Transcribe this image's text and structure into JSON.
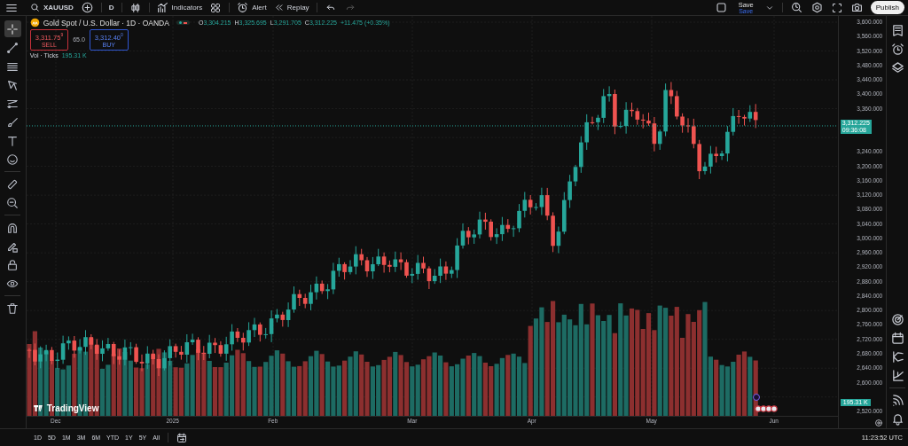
{
  "top_toolbar": {
    "symbol": "XAUUSD",
    "interval": "D",
    "indicators": "Indicators",
    "alert": "Alert",
    "replay": "Replay",
    "save": "Save",
    "save_note": "Save",
    "publish": "Publish"
  },
  "left_toolbar": [
    {
      "kind": "crosshair",
      "selected": true
    },
    {
      "kind": "line",
      "selected": false
    },
    {
      "kind": "fib",
      "selected": false
    },
    {
      "kind": "pattern",
      "selected": false
    },
    {
      "kind": "projection",
      "selected": false
    },
    {
      "kind": "brush",
      "selected": false
    },
    {
      "kind": "text",
      "selected": false
    },
    {
      "kind": "smiley",
      "selected": false
    },
    {
      "kind": "divider"
    },
    {
      "kind": "ruler",
      "selected": false
    },
    {
      "kind": "zoom",
      "selected": false
    },
    {
      "kind": "divider"
    },
    {
      "kind": "magnet",
      "selected": false
    },
    {
      "kind": "pencil-lock",
      "selected": false
    },
    {
      "kind": "lock",
      "selected": false
    },
    {
      "kind": "eye",
      "selected": false
    },
    {
      "kind": "divider"
    },
    {
      "kind": "trash",
      "selected": false
    }
  ],
  "legend": {
    "title": "Gold Spot / U.S. Dollar · 1D · OANDA",
    "ohlc": [
      {
        "key": "O",
        "value": "3,304.215"
      },
      {
        "key": "H",
        "value": "3,325.695"
      },
      {
        "key": "L",
        "value": "3,291.705"
      },
      {
        "key": "C",
        "value": "3,312.225"
      }
    ],
    "change": "+11.475 (+0.35%)"
  },
  "trade": {
    "sell_price": "3,311.75$^{9}$",
    "sell_label": "SELL",
    "spread": "65.0",
    "buy_price": "3,312.40$^{0}$",
    "buy_label": "BUY"
  },
  "volume_legend": {
    "label": "Vol · Ticks",
    "value": "195.31 K"
  },
  "price_axis": {
    "ticks": [
      "3,600.000",
      "3,560.000",
      "3,520.000",
      "3,480.000",
      "3,440.000",
      "3,400.000",
      "3,360.000",
      "3,240.000",
      "3,200.000",
      "3,160.000",
      "3,120.000",
      "3,080.000",
      "3,040.000",
      "3,000.000",
      "2,960.000",
      "2,920.000",
      "2,880.000",
      "2,840.000",
      "2,800.000",
      "2,760.000",
      "2,720.000",
      "2,680.000",
      "2,640.000",
      "2,600.000",
      "2,520.000"
    ],
    "current_price": "3,312.225",
    "countdown": "09:36:08",
    "volume_value": "195.31 K"
  },
  "time_axis": [
    "Dec",
    "2025",
    "Feb",
    "Mar",
    "Apr",
    "May",
    "Jun"
  ],
  "logo": "TradingView",
  "ranges": [
    "1D",
    "5D",
    "1M",
    "3M",
    "6M",
    "YTD",
    "1Y",
    "5Y",
    "All"
  ],
  "clock": "11:23:52 UTC"
}
